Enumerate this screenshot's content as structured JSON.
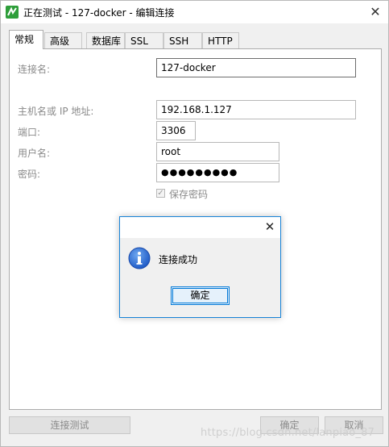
{
  "window": {
    "title": "正在测试 - 127-docker - 编辑连接"
  },
  "tabs": [
    {
      "label": "常规",
      "active": true
    },
    {
      "label": "高级",
      "active": false
    },
    {
      "label": "数据库",
      "active": false
    },
    {
      "label": "SSL",
      "active": false
    },
    {
      "label": "SSH",
      "active": false
    },
    {
      "label": "HTTP",
      "active": false
    }
  ],
  "form": {
    "connection_name_label": "连接名:",
    "connection_name_value": "127-docker",
    "host_label": "主机名或 IP 地址:",
    "host_value": "192.168.1.127",
    "port_label": "端口:",
    "port_value": "3306",
    "username_label": "用户名:",
    "username_value": "root",
    "password_label": "密码:",
    "password_value": "●●●●●●●●●",
    "save_password_label": "保存密码",
    "save_password_checked": true
  },
  "footer": {
    "test_connection_label": "连接测试",
    "ok_label": "确定",
    "cancel_label": "取消"
  },
  "dialog": {
    "message": "连接成功",
    "ok_label": "确定"
  },
  "watermark": "https://blog.csdn.net/lanpiao_87",
  "colors": {
    "accent": "#0078d7",
    "dialog_border": "#1883d7",
    "app_icon": "#2e9e3a",
    "info_icon": "#2a6fd6"
  }
}
